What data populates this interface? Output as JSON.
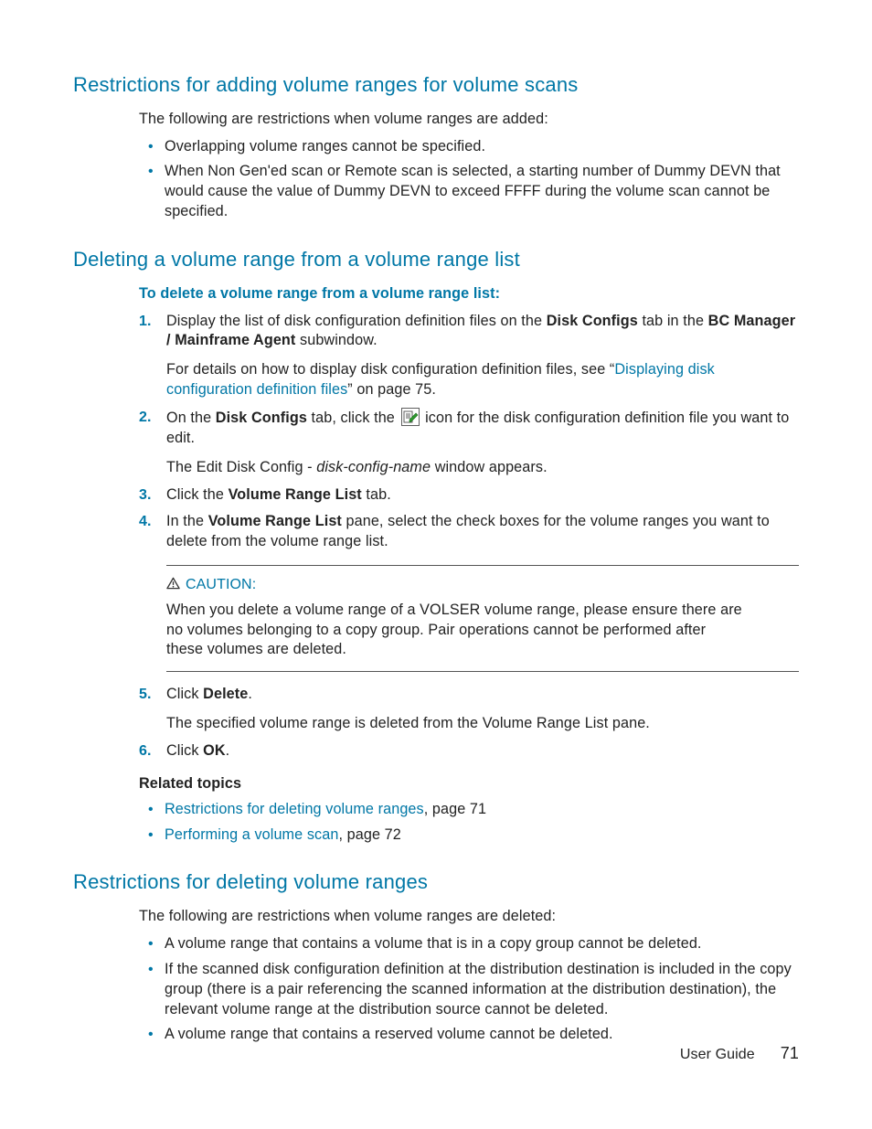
{
  "sec1": {
    "heading": "Restrictions for adding volume ranges for volume scans",
    "intro": "The following are restrictions when volume ranges are added:",
    "bullets": [
      "Overlapping volume ranges cannot be specified.",
      "When Non Gen'ed scan or Remote scan is selected, a starting number of Dummy DEVN that would cause the value of Dummy DEVN to exceed FFFF during the volume scan cannot be specified."
    ]
  },
  "sec2": {
    "heading": "Deleting a volume range from a volume range list",
    "procTitle": "To delete a volume range from a volume range list:",
    "step1": {
      "pre": "Display the list of disk configuration definition files on the ",
      "b1": "Disk Configs",
      "mid": " tab in the ",
      "b2": "BC Manager / Mainframe Agent",
      "end": " subwindow.",
      "sub_pre": "For details on how to display disk configuration definition files, see “",
      "sub_link": "Displaying disk configuration definition files",
      "sub_post": "” on page 75."
    },
    "step2": {
      "pre": "On the ",
      "b1": "Disk Configs",
      "mid": " tab, click the ",
      "post": " icon for the disk configuration definition file you want to edit.",
      "sub_pre": "The Edit Disk Config - ",
      "sub_italic": "disk-config-name",
      "sub_post": " window appears."
    },
    "step3": {
      "pre": "Click the ",
      "b1": "Volume Range List",
      "post": " tab."
    },
    "step4": {
      "pre": "In the ",
      "b1": "Volume Range List",
      "post": " pane, select the check boxes for the volume ranges you want to delete from the volume range list."
    },
    "caution": {
      "label": "CAUTION:",
      "text": "When you delete a volume range of a VOLSER volume range, please ensure there are no volumes belonging to a copy group. Pair operations cannot be performed after these volumes are deleted."
    },
    "step5": {
      "pre": "Click ",
      "b1": "Delete",
      "post": ".",
      "sub": "The specified volume range is deleted from the Volume Range List pane."
    },
    "step6": {
      "pre": "Click ",
      "b1": "OK",
      "post": "."
    },
    "relatedHead": "Related topics",
    "related": [
      {
        "link": "Restrictions for deleting volume ranges",
        "rest": ", page 71"
      },
      {
        "link": "Performing a volume scan",
        "rest": ", page 72"
      }
    ]
  },
  "sec3": {
    "heading": "Restrictions for deleting volume ranges",
    "intro": "The following are restrictions when volume ranges are deleted:",
    "bullets": [
      "A volume range that contains a volume that is in a copy group cannot be deleted.",
      "If the scanned disk configuration definition at the distribution destination is included in the copy group (there is a pair referencing the scanned information at the distribution destination), the relevant volume range at the distribution source cannot be deleted.",
      "A volume range that contains a reserved volume cannot be deleted."
    ]
  },
  "footer": {
    "label": "User Guide",
    "page": "71"
  }
}
